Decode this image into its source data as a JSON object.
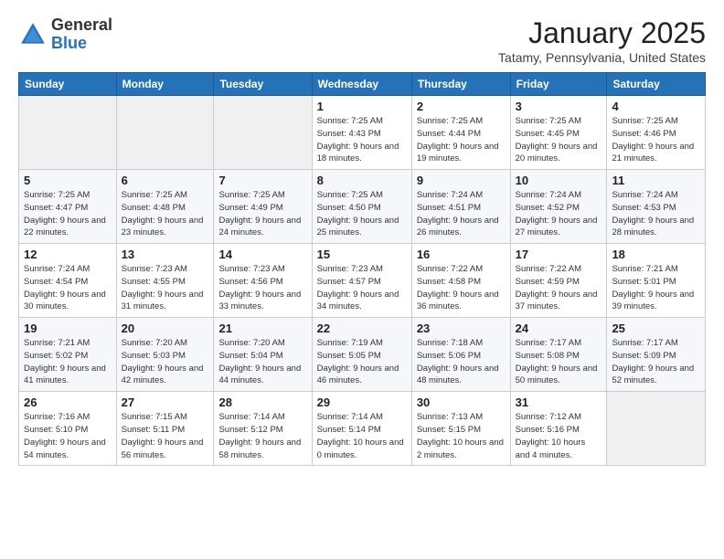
{
  "logo": {
    "general": "General",
    "blue": "Blue"
  },
  "header": {
    "month": "January 2025",
    "location": "Tatamy, Pennsylvania, United States"
  },
  "weekdays": [
    "Sunday",
    "Monday",
    "Tuesday",
    "Wednesday",
    "Thursday",
    "Friday",
    "Saturday"
  ],
  "weeks": [
    [
      {
        "day": "",
        "empty": true
      },
      {
        "day": "",
        "empty": true
      },
      {
        "day": "",
        "empty": true
      },
      {
        "day": "1",
        "sunrise": "Sunrise: 7:25 AM",
        "sunset": "Sunset: 4:43 PM",
        "daylight": "Daylight: 9 hours and 18 minutes."
      },
      {
        "day": "2",
        "sunrise": "Sunrise: 7:25 AM",
        "sunset": "Sunset: 4:44 PM",
        "daylight": "Daylight: 9 hours and 19 minutes."
      },
      {
        "day": "3",
        "sunrise": "Sunrise: 7:25 AM",
        "sunset": "Sunset: 4:45 PM",
        "daylight": "Daylight: 9 hours and 20 minutes."
      },
      {
        "day": "4",
        "sunrise": "Sunrise: 7:25 AM",
        "sunset": "Sunset: 4:46 PM",
        "daylight": "Daylight: 9 hours and 21 minutes."
      }
    ],
    [
      {
        "day": "5",
        "sunrise": "Sunrise: 7:25 AM",
        "sunset": "Sunset: 4:47 PM",
        "daylight": "Daylight: 9 hours and 22 minutes."
      },
      {
        "day": "6",
        "sunrise": "Sunrise: 7:25 AM",
        "sunset": "Sunset: 4:48 PM",
        "daylight": "Daylight: 9 hours and 23 minutes."
      },
      {
        "day": "7",
        "sunrise": "Sunrise: 7:25 AM",
        "sunset": "Sunset: 4:49 PM",
        "daylight": "Daylight: 9 hours and 24 minutes."
      },
      {
        "day": "8",
        "sunrise": "Sunrise: 7:25 AM",
        "sunset": "Sunset: 4:50 PM",
        "daylight": "Daylight: 9 hours and 25 minutes."
      },
      {
        "day": "9",
        "sunrise": "Sunrise: 7:24 AM",
        "sunset": "Sunset: 4:51 PM",
        "daylight": "Daylight: 9 hours and 26 minutes."
      },
      {
        "day": "10",
        "sunrise": "Sunrise: 7:24 AM",
        "sunset": "Sunset: 4:52 PM",
        "daylight": "Daylight: 9 hours and 27 minutes."
      },
      {
        "day": "11",
        "sunrise": "Sunrise: 7:24 AM",
        "sunset": "Sunset: 4:53 PM",
        "daylight": "Daylight: 9 hours and 28 minutes."
      }
    ],
    [
      {
        "day": "12",
        "sunrise": "Sunrise: 7:24 AM",
        "sunset": "Sunset: 4:54 PM",
        "daylight": "Daylight: 9 hours and 30 minutes."
      },
      {
        "day": "13",
        "sunrise": "Sunrise: 7:23 AM",
        "sunset": "Sunset: 4:55 PM",
        "daylight": "Daylight: 9 hours and 31 minutes."
      },
      {
        "day": "14",
        "sunrise": "Sunrise: 7:23 AM",
        "sunset": "Sunset: 4:56 PM",
        "daylight": "Daylight: 9 hours and 33 minutes."
      },
      {
        "day": "15",
        "sunrise": "Sunrise: 7:23 AM",
        "sunset": "Sunset: 4:57 PM",
        "daylight": "Daylight: 9 hours and 34 minutes."
      },
      {
        "day": "16",
        "sunrise": "Sunrise: 7:22 AM",
        "sunset": "Sunset: 4:58 PM",
        "daylight": "Daylight: 9 hours and 36 minutes."
      },
      {
        "day": "17",
        "sunrise": "Sunrise: 7:22 AM",
        "sunset": "Sunset: 4:59 PM",
        "daylight": "Daylight: 9 hours and 37 minutes."
      },
      {
        "day": "18",
        "sunrise": "Sunrise: 7:21 AM",
        "sunset": "Sunset: 5:01 PM",
        "daylight": "Daylight: 9 hours and 39 minutes."
      }
    ],
    [
      {
        "day": "19",
        "sunrise": "Sunrise: 7:21 AM",
        "sunset": "Sunset: 5:02 PM",
        "daylight": "Daylight: 9 hours and 41 minutes."
      },
      {
        "day": "20",
        "sunrise": "Sunrise: 7:20 AM",
        "sunset": "Sunset: 5:03 PM",
        "daylight": "Daylight: 9 hours and 42 minutes."
      },
      {
        "day": "21",
        "sunrise": "Sunrise: 7:20 AM",
        "sunset": "Sunset: 5:04 PM",
        "daylight": "Daylight: 9 hours and 44 minutes."
      },
      {
        "day": "22",
        "sunrise": "Sunrise: 7:19 AM",
        "sunset": "Sunset: 5:05 PM",
        "daylight": "Daylight: 9 hours and 46 minutes."
      },
      {
        "day": "23",
        "sunrise": "Sunrise: 7:18 AM",
        "sunset": "Sunset: 5:06 PM",
        "daylight": "Daylight: 9 hours and 48 minutes."
      },
      {
        "day": "24",
        "sunrise": "Sunrise: 7:17 AM",
        "sunset": "Sunset: 5:08 PM",
        "daylight": "Daylight: 9 hours and 50 minutes."
      },
      {
        "day": "25",
        "sunrise": "Sunrise: 7:17 AM",
        "sunset": "Sunset: 5:09 PM",
        "daylight": "Daylight: 9 hours and 52 minutes."
      }
    ],
    [
      {
        "day": "26",
        "sunrise": "Sunrise: 7:16 AM",
        "sunset": "Sunset: 5:10 PM",
        "daylight": "Daylight: 9 hours and 54 minutes."
      },
      {
        "day": "27",
        "sunrise": "Sunrise: 7:15 AM",
        "sunset": "Sunset: 5:11 PM",
        "daylight": "Daylight: 9 hours and 56 minutes."
      },
      {
        "day": "28",
        "sunrise": "Sunrise: 7:14 AM",
        "sunset": "Sunset: 5:12 PM",
        "daylight": "Daylight: 9 hours and 58 minutes."
      },
      {
        "day": "29",
        "sunrise": "Sunrise: 7:14 AM",
        "sunset": "Sunset: 5:14 PM",
        "daylight": "Daylight: 10 hours and 0 minutes."
      },
      {
        "day": "30",
        "sunrise": "Sunrise: 7:13 AM",
        "sunset": "Sunset: 5:15 PM",
        "daylight": "Daylight: 10 hours and 2 minutes."
      },
      {
        "day": "31",
        "sunrise": "Sunrise: 7:12 AM",
        "sunset": "Sunset: 5:16 PM",
        "daylight": "Daylight: 10 hours and 4 minutes."
      },
      {
        "day": "",
        "empty": true
      }
    ]
  ]
}
